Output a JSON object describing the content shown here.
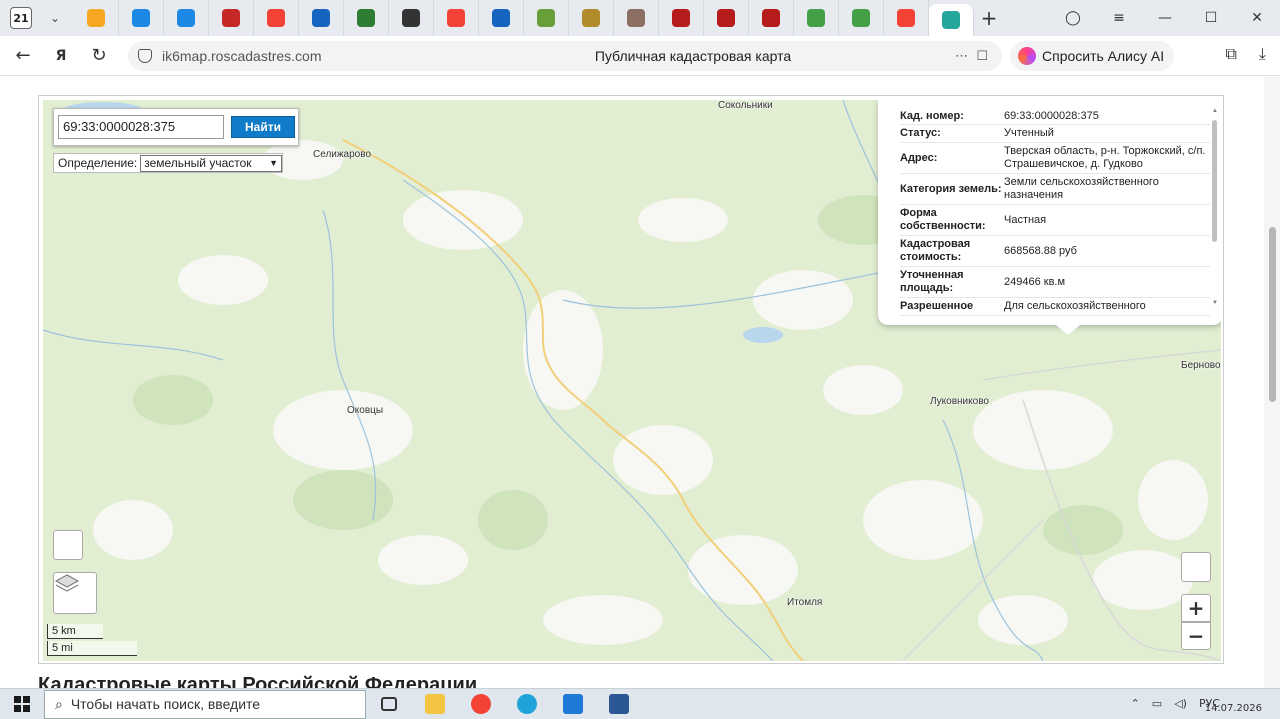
{
  "browser": {
    "tab_count": "21",
    "tabs": [
      {
        "icon": "mail-icon",
        "color": "#f5a623"
      },
      {
        "icon": "cloud-icon",
        "color": "#1e88e5"
      },
      {
        "icon": "cloud-icon",
        "color": "#1e88e5"
      },
      {
        "icon": "emblem-icon",
        "color": "#c62828"
      },
      {
        "icon": "yandex-icon",
        "color": "#f44336"
      },
      {
        "icon": "s-icon",
        "color": "#1565c0"
      },
      {
        "icon": "anchor-icon",
        "color": "#2e7d32"
      },
      {
        "icon": "soccer-icon",
        "color": "#333333"
      },
      {
        "icon": "yandex-icon",
        "color": "#f44336"
      },
      {
        "icon": "u-icon",
        "color": "#1565c0"
      },
      {
        "icon": "emblem-icon",
        "color": "#689f38"
      },
      {
        "icon": "emblem-icon",
        "color": "#b08d2a"
      },
      {
        "icon": "avatar-icon",
        "color": "#8d6e63"
      },
      {
        "icon": "museum-icon",
        "color": "#b71c1c"
      },
      {
        "icon": "museum-icon",
        "color": "#b71c1c"
      },
      {
        "icon": "museum-icon",
        "color": "#b71c1c"
      },
      {
        "icon": "apps-icon",
        "color": "#43a047"
      },
      {
        "icon": "apps-icon",
        "color": "#43a047"
      },
      {
        "icon": "yandex-icon",
        "color": "#f44336"
      },
      {
        "icon": "map-icon",
        "color": "#26a69a"
      }
    ],
    "url": "ik6map.roscadastres.com",
    "page_title": "Публичная кадастровая карта",
    "alice_label": "Спросить Алису AI"
  },
  "map": {
    "search_value": "69:33:0000028:375",
    "search_button": "Найти",
    "definition_label": "Определение:",
    "definition_value": "земельный участок",
    "places": {
      "sokolniki": "Сокольники",
      "selizharovo": "Селижарово",
      "okovtsy": "Оковцы",
      "lukovnikovo": "Луковниково",
      "bernovo": "Берново",
      "itomlya": "Итомля"
    },
    "scale_km": "5 km",
    "scale_mi": "5 mi",
    "zoom_in": "+",
    "zoom_out": "−"
  },
  "popup": {
    "rows": [
      {
        "key": "Кад. номер:",
        "value": "69:33:0000028:375"
      },
      {
        "key": "Статус:",
        "value": "Учтенный"
      },
      {
        "key": "Адрес:",
        "value": "Тверская область, р-н. Торжокский, с/п. Страшевичское, д. Гудково"
      },
      {
        "key": "Категория земель:",
        "value": "Земли сельскохозяйственного назначения"
      },
      {
        "key": "Форма собственности:",
        "value": "Частная"
      },
      {
        "key": "Кадастровая стоимость:",
        "value": "668568.88 руб"
      },
      {
        "key": "Уточненная площадь:",
        "value": "249466 кв.м"
      },
      {
        "key": "Разрешенное",
        "value": "Для сельскохозяйственного"
      }
    ]
  },
  "page": {
    "heading": "Кадастровые карты Российской Федерации"
  },
  "taskbar": {
    "search_placeholder": "Чтобы начать поиск, введите",
    "language": "РУС",
    "date": "14.07.2026"
  }
}
